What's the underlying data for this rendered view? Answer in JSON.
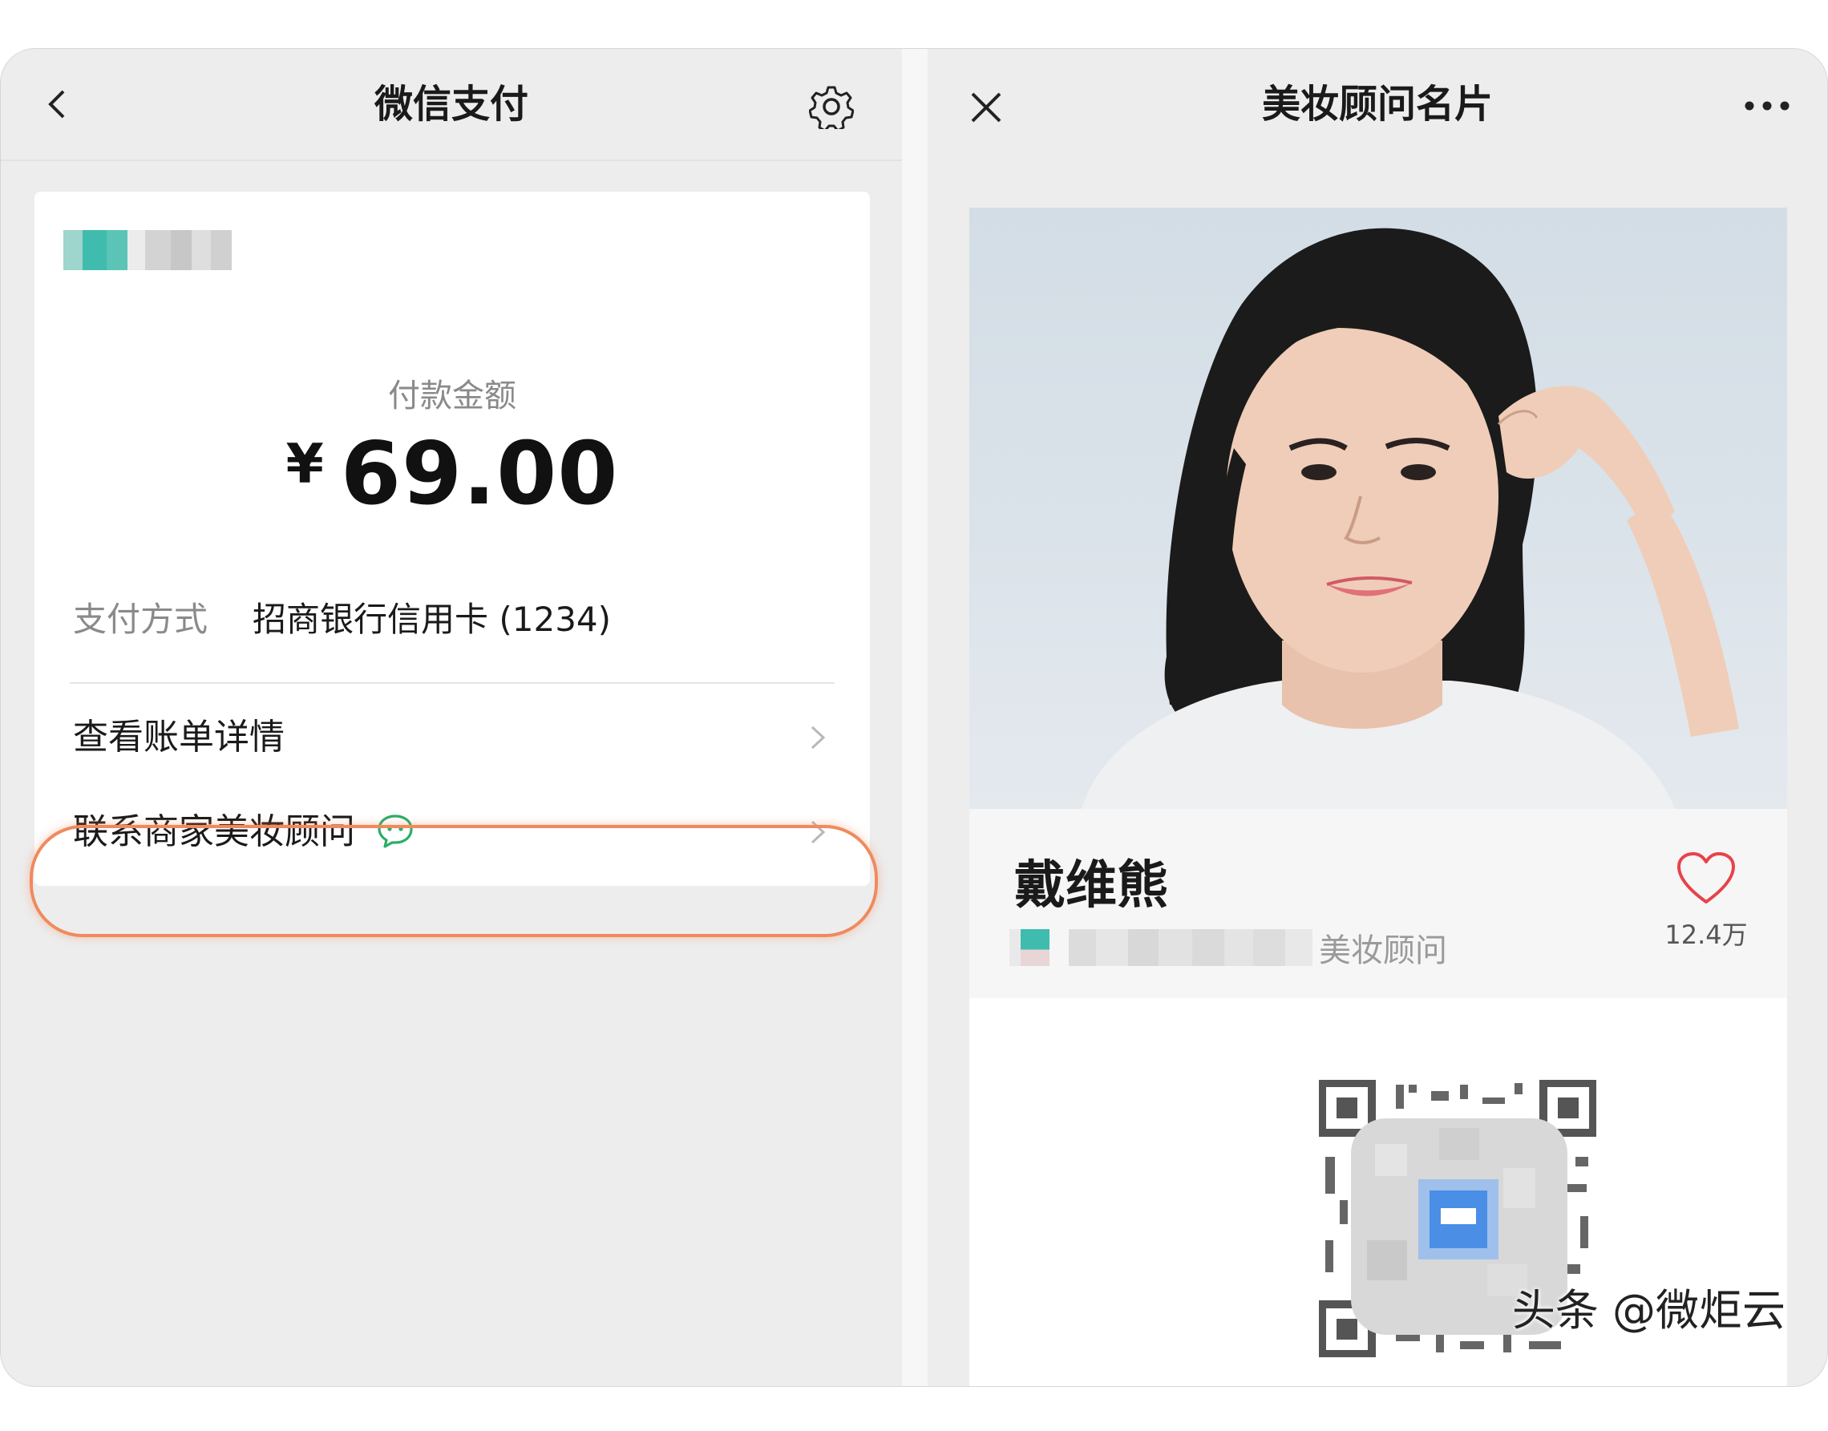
{
  "left": {
    "title": "微信支付",
    "amount_label": "付款金额",
    "currency": "¥",
    "amount": "69.00",
    "payment_method_label": "支付方式",
    "payment_method_value": "招商银行信用卡 (1234)",
    "menu": [
      {
        "label": "查看账单详情"
      },
      {
        "label": "联系商家美妆顾问"
      }
    ]
  },
  "right": {
    "title": "美妆顾问名片",
    "name": "戴维熊",
    "role_suffix": "美妆顾问",
    "likes": "12.4万"
  },
  "watermark": "头条 @微炬云",
  "colors": {
    "highlight_ring": "#f08a5d",
    "wechat_green": "#2aae67",
    "heart_red": "#e8424a"
  },
  "icons": [
    "back-icon",
    "settings-gear-icon",
    "chevron-right-icon",
    "wechat-chat-icon",
    "close-icon",
    "more-dots-icon",
    "heart-icon",
    "qr-code"
  ]
}
